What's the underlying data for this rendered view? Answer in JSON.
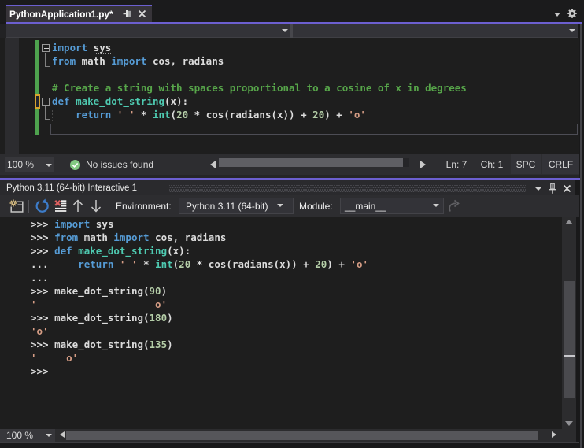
{
  "accent_color": "#6c5fd0",
  "palette": {
    "kw": "#569cd6",
    "pl": "#dcdcdc",
    "fn": "#4ec9b0",
    "typ": "#4ec9b0",
    "num": "#b5cea8",
    "str": "#d69d85",
    "com": "#57a64a",
    "prm": "#dcdcdc"
  },
  "tab": {
    "title": "PythonApplication1.py*"
  },
  "editor_status": {
    "zoom": "100 %",
    "message": "No issues found",
    "line": "Ln: 7",
    "column": "Ch: 1",
    "space_mode": "SPC",
    "line_ending": "CRLF"
  },
  "editor_lines": [
    [
      [
        "kw",
        "import"
      ],
      [
        "pl",
        " "
      ],
      [
        "plu",
        "sys"
      ]
    ],
    [
      [
        "kw",
        "from"
      ],
      [
        "pl",
        " math "
      ],
      [
        "kw",
        "import"
      ],
      [
        "pl",
        " cos, radians"
      ]
    ],
    [],
    [
      [
        "com",
        "# Create a string with spaces proportional to a cosine of x in degrees"
      ]
    ],
    [
      [
        "kw",
        "def"
      ],
      [
        "pl",
        " "
      ],
      [
        "fn",
        "make_dot_string"
      ],
      [
        "pl",
        "(x):"
      ]
    ],
    [
      [
        "pl",
        "    "
      ],
      [
        "kw",
        "return"
      ],
      [
        "pl",
        " "
      ],
      [
        "str",
        "' '"
      ],
      [
        "pl",
        " * "
      ],
      [
        "typ",
        "int"
      ],
      [
        "pl",
        "("
      ],
      [
        "num",
        "20"
      ],
      [
        "pl",
        " * cos(radians(x)) + "
      ],
      [
        "num",
        "20"
      ],
      [
        "pl",
        ") + "
      ],
      [
        "str",
        "'o'"
      ]
    ],
    []
  ],
  "interactive": {
    "title": "Python 3.11 (64-bit) Interactive 1",
    "toolbar": {
      "environment_label": "Environment:",
      "environment_value": "Python 3.11 (64-bit)",
      "module_label": "Module:",
      "module_value": "__main__"
    },
    "zoom": "100 %"
  },
  "interactive_lines": [
    [
      [
        "prm",
        ">>> "
      ],
      [
        "kw",
        "import"
      ],
      [
        "pl",
        " sys"
      ]
    ],
    [
      [
        "prm",
        ">>> "
      ],
      [
        "kw",
        "from"
      ],
      [
        "pl",
        " math "
      ],
      [
        "kw",
        "import"
      ],
      [
        "pl",
        " cos, radians"
      ]
    ],
    [
      [
        "prm",
        ">>> "
      ],
      [
        "kw",
        "def"
      ],
      [
        "pl",
        " "
      ],
      [
        "fn",
        "make_dot_string"
      ],
      [
        "pl",
        "(x):"
      ]
    ],
    [
      [
        "prm",
        "... "
      ],
      [
        "pl",
        "    "
      ],
      [
        "kw",
        "return"
      ],
      [
        "pl",
        " "
      ],
      [
        "str",
        "' '"
      ],
      [
        "pl",
        " * "
      ],
      [
        "typ",
        "int"
      ],
      [
        "pl",
        "("
      ],
      [
        "num",
        "20"
      ],
      [
        "pl",
        " * cos(radians(x)) + "
      ],
      [
        "num",
        "20"
      ],
      [
        "pl",
        ") + "
      ],
      [
        "str",
        "'o'"
      ]
    ],
    [
      [
        "prm",
        "..."
      ]
    ],
    [
      [
        "prm",
        ">>> "
      ],
      [
        "pl",
        "make_dot_string("
      ],
      [
        "num",
        "90"
      ],
      [
        "pl",
        ")"
      ]
    ],
    [
      [
        "str",
        "'                    o'"
      ]
    ],
    [
      [
        "prm",
        ">>> "
      ],
      [
        "pl",
        "make_dot_string("
      ],
      [
        "num",
        "180"
      ],
      [
        "pl",
        ")"
      ]
    ],
    [
      [
        "str",
        "'o'"
      ]
    ],
    [
      [
        "prm",
        ">>> "
      ],
      [
        "pl",
        "make_dot_string("
      ],
      [
        "num",
        "135"
      ],
      [
        "pl",
        ")"
      ]
    ],
    [
      [
        "str",
        "'     o'"
      ]
    ],
    [
      [
        "prm",
        ">>>"
      ]
    ]
  ]
}
